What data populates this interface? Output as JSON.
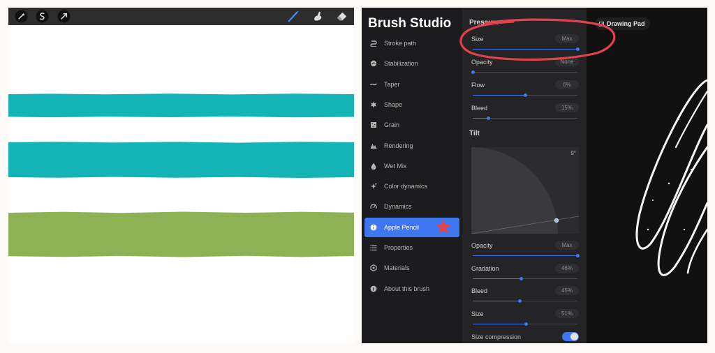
{
  "colors": {
    "canvas_bg": "#ffffff",
    "toolbar": "#2d2d2d",
    "teal_stroke": "#14b3b5",
    "green_stroke": "#8db256",
    "accent": "#3f76f2",
    "annotation_red": "#e2424b",
    "studio_bg": "#111111",
    "sidebar_bg": "#1c1c1e",
    "settings_bg": "#242426"
  },
  "canvas": {
    "toolbar_left": [
      "adjustments-wand-icon",
      "selection-s-icon",
      "transform-arrow-icon"
    ],
    "toolbar_right": [
      "brush-icon",
      "smudge-icon",
      "eraser-icon"
    ]
  },
  "studio": {
    "title": "Brush Studio",
    "sidebar": [
      {
        "label": "Stroke path",
        "icon": "stroke-path-icon"
      },
      {
        "label": "Stabilization",
        "icon": "stabilization-icon"
      },
      {
        "label": "Taper",
        "icon": "taper-icon"
      },
      {
        "label": "Shape",
        "icon": "shape-icon"
      },
      {
        "label": "Grain",
        "icon": "grain-icon"
      },
      {
        "label": "Rendering",
        "icon": "rendering-icon"
      },
      {
        "label": "Wet Mix",
        "icon": "wet-mix-icon"
      },
      {
        "label": "Color dynamics",
        "icon": "color-dynamics-icon"
      },
      {
        "label": "Dynamics",
        "icon": "dynamics-icon"
      },
      {
        "label": "Apple Pencil",
        "icon": "apple-pencil-icon",
        "active": true
      },
      {
        "label": "Properties",
        "icon": "properties-icon"
      },
      {
        "label": "Materials",
        "icon": "materials-icon"
      },
      {
        "label": "About this brush",
        "icon": "info-icon"
      }
    ],
    "pressure": {
      "title": "Pressure",
      "sliders": [
        {
          "label": "Size",
          "value": "Max",
          "level": 1.0
        },
        {
          "label": "Opacity",
          "value": "None",
          "level": 0.0
        },
        {
          "label": "Flow",
          "value": "0%",
          "level": 0.5
        },
        {
          "label": "Bleed",
          "value": "15%",
          "level": 0.15
        }
      ]
    },
    "tilt": {
      "title": "Tilt",
      "angle": "9°",
      "sliders": [
        {
          "label": "Opacity",
          "value": "Max",
          "level": 1.0
        },
        {
          "label": "Gradation",
          "value": "46%",
          "level": 0.46
        },
        {
          "label": "Bleed",
          "value": "45%",
          "level": 0.45
        },
        {
          "label": "Size",
          "value": "51%",
          "level": 0.51
        }
      ],
      "toggle": {
        "label": "Size compression",
        "on": true
      }
    },
    "preview": {
      "label": "Drawing Pad",
      "icon": "drawing-pad-icon"
    }
  }
}
